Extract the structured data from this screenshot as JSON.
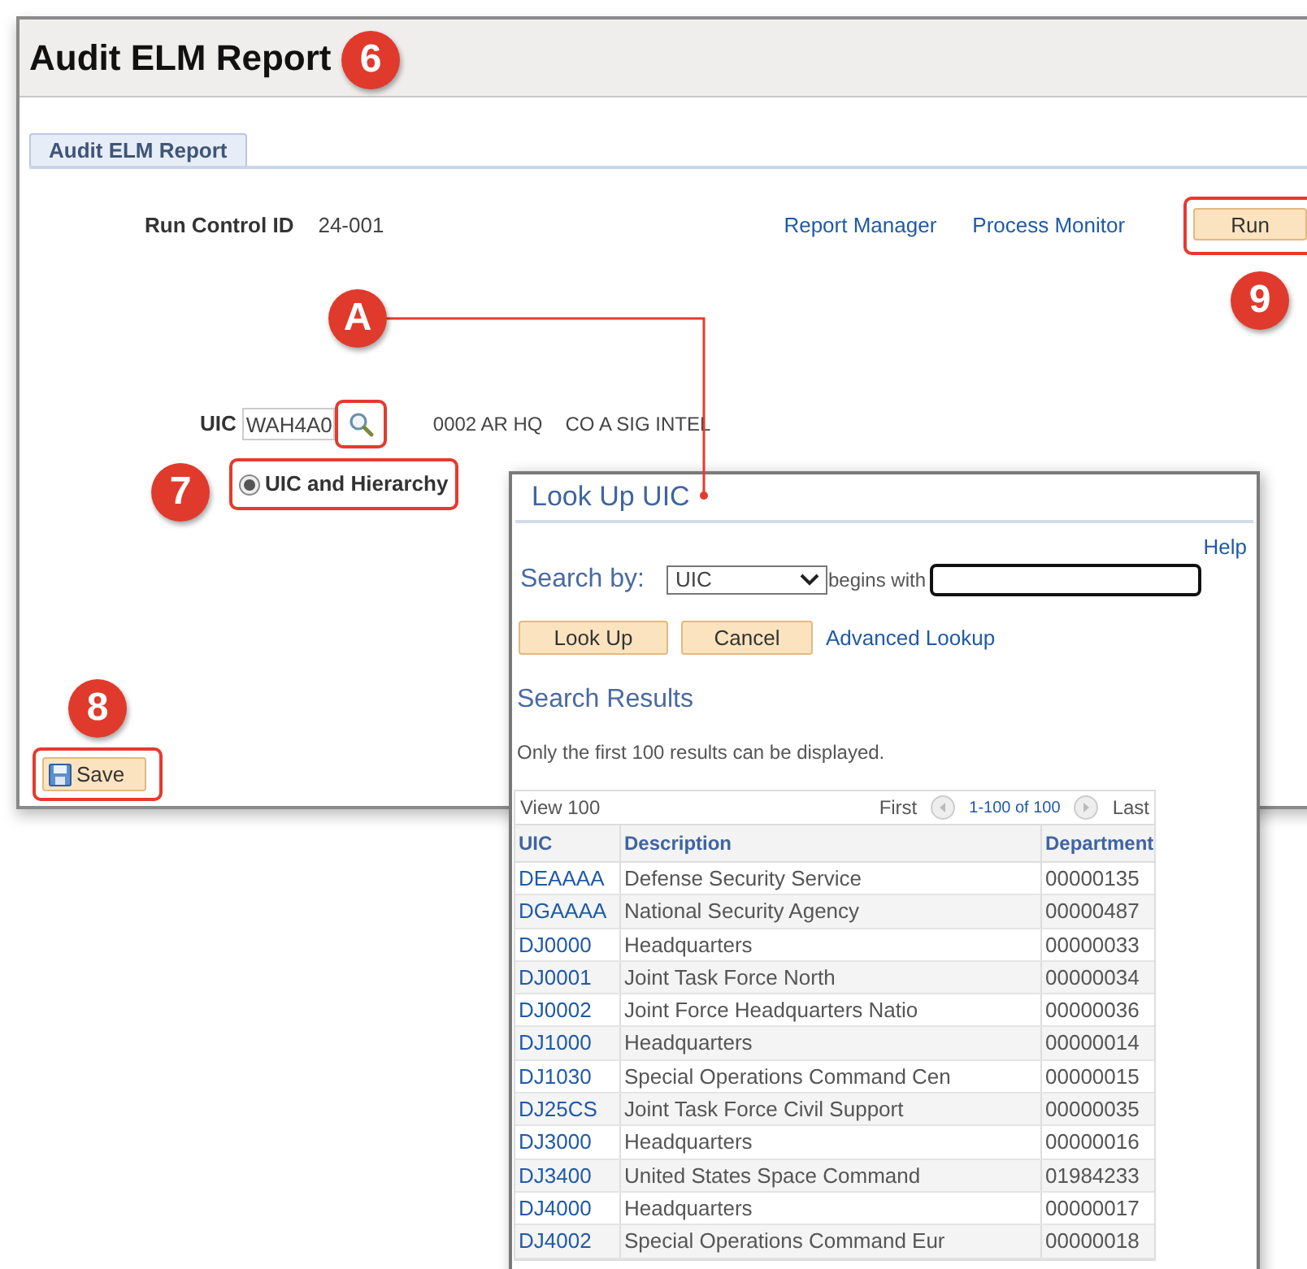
{
  "page": {
    "title": "Audit ELM Report"
  },
  "tabs": [
    {
      "label": "Audit ELM Report",
      "selected": true
    }
  ],
  "run_control": {
    "label": "Run Control ID",
    "value": "24-001"
  },
  "links": [
    "Report Manager",
    "Process Monitor"
  ],
  "run_button": "Run",
  "uic": {
    "label": "UIC",
    "value": "WAH4A0",
    "descriptions": [
      "0002 AR HQ",
      "CO A SIG INTEL"
    ]
  },
  "radio": {
    "label": "UIC and Hierarchy",
    "selected": true
  },
  "save_button": "Save",
  "callouts": [
    {
      "label": "6"
    },
    {
      "label": "A"
    },
    {
      "label": "7"
    },
    {
      "label": "8"
    },
    {
      "label": "9"
    }
  ],
  "lookup": {
    "title": "Look Up UIC",
    "help": "Help",
    "search_by_label": "Search by:",
    "search_by_value": "UIC",
    "operator": "begins with",
    "buttons": [
      "Look Up",
      "Cancel"
    ],
    "advanced_link": "Advanced Lookup",
    "results_title": "Search Results",
    "note": "Only the first 100 results can be displayed.",
    "grid": {
      "view": "View 100",
      "first": "First",
      "range": "1-100 of 100",
      "last": "Last",
      "columns": [
        "UIC",
        "Description",
        "Department"
      ],
      "rows": [
        [
          "DEAAAA",
          "Defense Security Service",
          "00000135"
        ],
        [
          "DGAAAA",
          "National Security Agency",
          "00000487"
        ],
        [
          "DJ0000",
          "Headquarters",
          "00000033"
        ],
        [
          "DJ0001",
          "Joint Task Force North",
          "00000034"
        ],
        [
          "DJ0002",
          "Joint Force Headquarters Natio",
          "00000036"
        ],
        [
          "DJ1000",
          "Headquarters",
          "00000014"
        ],
        [
          "DJ1030",
          "Special Operations Command Cen",
          "00000015"
        ],
        [
          "DJ25CS",
          "Joint Task Force Civil Support",
          "00000035"
        ],
        [
          "DJ3000",
          "Headquarters",
          "00000016"
        ],
        [
          "DJ3400",
          "United States Space Command",
          "01984233"
        ],
        [
          "DJ4000",
          "Headquarters",
          "00000017"
        ],
        [
          "DJ4002",
          "Special Operations Command Eur",
          "00000018"
        ]
      ]
    }
  }
}
